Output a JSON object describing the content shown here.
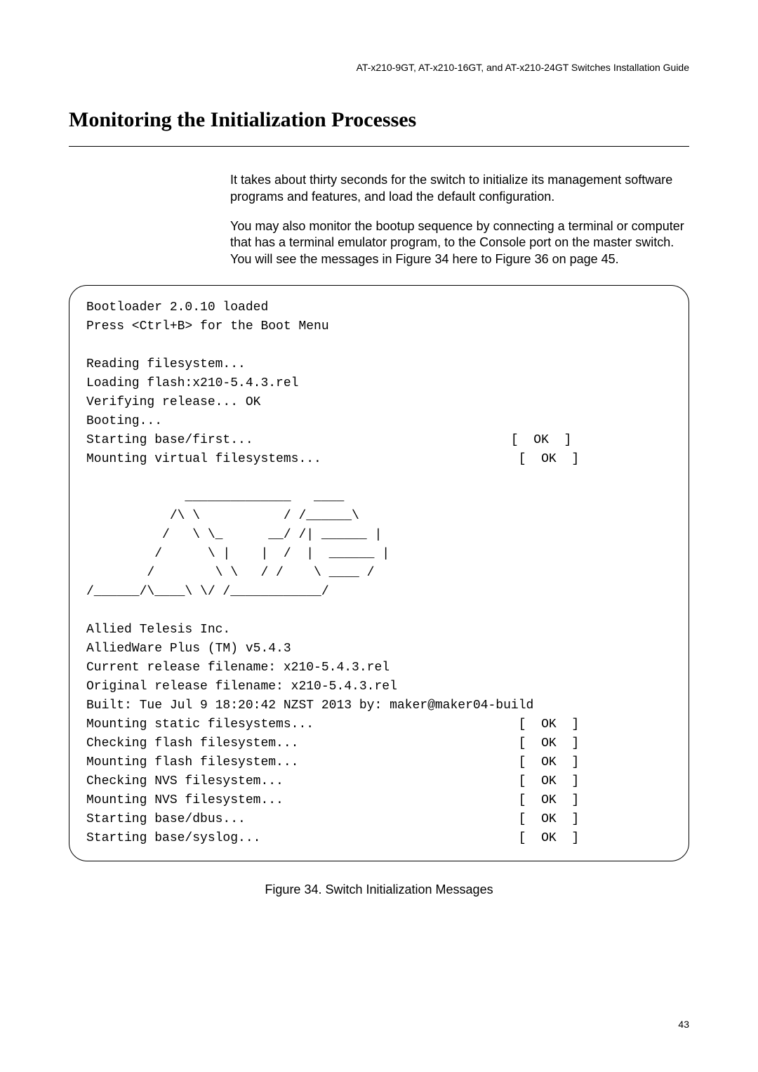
{
  "running_header": "AT-x210-9GT, AT-x210-16GT, and AT-x210-24GT Switches Installation Guide",
  "section_title": "Monitoring the Initialization Processes",
  "body": {
    "para1": "It takes about thirty seconds for the switch to initialize its management software programs and features, and load the default configuration.",
    "para2": "You may also monitor the bootup sequence by connecting a terminal or computer that has a terminal emulator program, to the Console port on the master switch. You will see the messages in Figure 34 here to Figure 36 on page 45."
  },
  "terminal": "Bootloader 2.0.10 loaded\nPress <Ctrl+B> for the Boot Menu\n\nReading filesystem...\nLoading flash:x210-5.4.3.rel\nVerifying release... OK\nBooting...\nStarting base/first...                                  [  OK  ]\nMounting virtual filesystems...                          [  OK  ]\n\n             ______________   ____\n           /\\ \\           / /______\\\n          /   \\ \\_      __/ /| ______ |\n         /      \\ |    |  /  |  ______ |\n        /        \\ \\   / /    \\ ____ /\n/______/\\____\\ \\/ /____________/\n\nAllied Telesis Inc.\nAlliedWare Plus (TM) v5.4.3\nCurrent release filename: x210-5.4.3.rel\nOriginal release filename: x210-5.4.3.rel\nBuilt: Tue Jul 9 18:20:42 NZST 2013 by: maker@maker04-build\nMounting static filesystems...                           [  OK  ]\nChecking flash filesystem...                             [  OK  ]\nMounting flash filesystem...                             [  OK  ]\nChecking NVS filesystem...                               [  OK  ]\nMounting NVS filesystem...                               [  OK  ]\nStarting base/dbus...                                    [  OK  ]\nStarting base/syslog...                                  [  OK  ]",
  "figure_caption": "Figure 34. Switch Initialization Messages",
  "page_number": "43"
}
